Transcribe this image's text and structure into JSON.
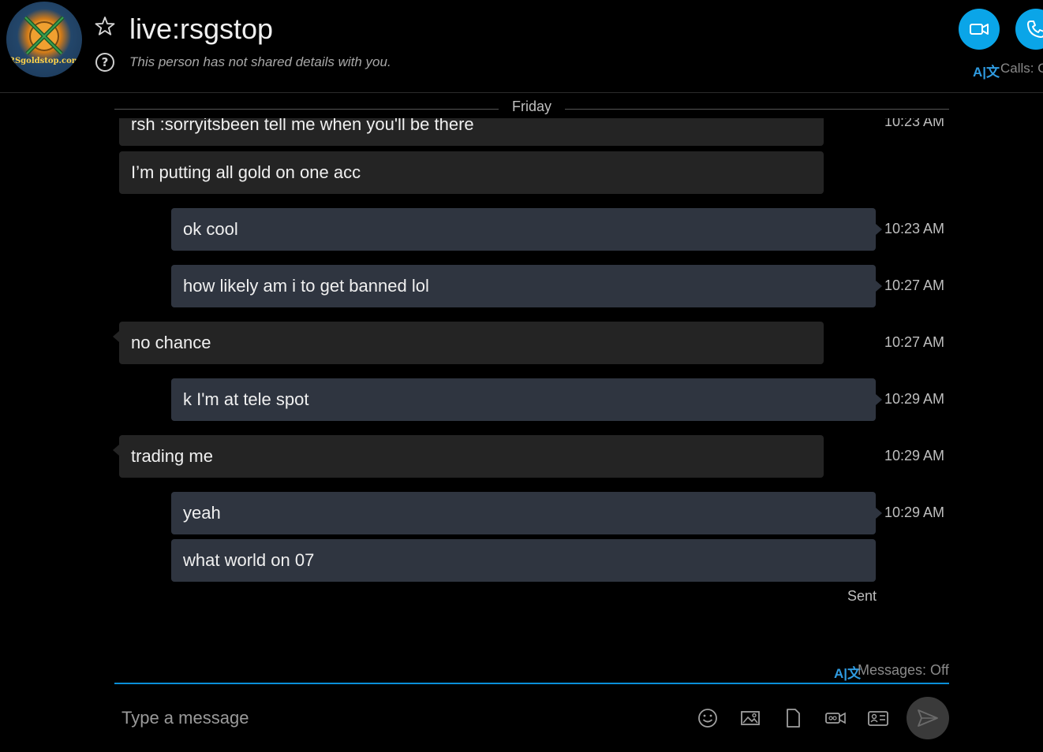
{
  "header": {
    "avatar_text": "RSgoldstop.com",
    "contact_name": "live:rsgstop",
    "subtitle": "This person has not shared details with you.",
    "help_glyph": "?",
    "calls_label": "Calls: O",
    "translate_glyph": "A|文",
    "accent_color": "#0aa5e8"
  },
  "conversation": {
    "date_separator": "Friday",
    "messages": [
      {
        "direction": "incoming",
        "text": "rsh :sorryitsbeen tell me when you'll be there",
        "time": "10:23 AM"
      },
      {
        "direction": "incoming",
        "text": "I’m putting all gold on one acc",
        "time": ""
      },
      {
        "direction": "outgoing",
        "text": "ok cool",
        "time": "10:23 AM"
      },
      {
        "direction": "outgoing",
        "text": "how likely am i to get banned lol",
        "time": "10:27 AM"
      },
      {
        "direction": "incoming",
        "text": "no chance",
        "time": "10:27 AM"
      },
      {
        "direction": "outgoing",
        "text": "k I'm at tele spot",
        "time": "10:29 AM"
      },
      {
        "direction": "incoming",
        "text": "trading me",
        "time": "10:29 AM"
      },
      {
        "direction": "outgoing",
        "text": "yeah",
        "time": "10:29 AM"
      },
      {
        "direction": "outgoing",
        "text": "what world on 07",
        "time": ""
      }
    ],
    "sent_status": "Sent"
  },
  "composer": {
    "translate_glyph": "A|文",
    "messages_translation": "Messages: Off",
    "placeholder": "Type a message",
    "tools": [
      "emoji-icon",
      "image-icon",
      "file-icon",
      "video-message-icon",
      "contact-card-icon",
      "send-icon"
    ]
  }
}
